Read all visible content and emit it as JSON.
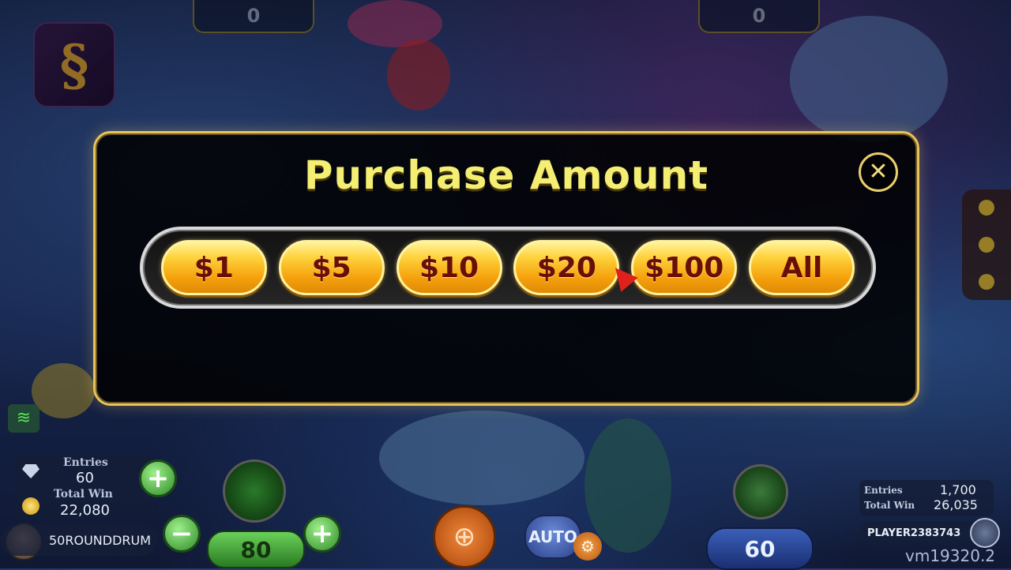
{
  "modal": {
    "title": "Purchase Amount",
    "close_icon": "close-icon",
    "amounts": [
      "$1",
      "$5",
      "$10",
      "$20",
      "$100",
      "All"
    ]
  },
  "top": {
    "left_counter": "0",
    "right_counter": "0"
  },
  "hud_left": {
    "entries_label": "Entries",
    "entries_value": "60",
    "total_win_label": "Total Win",
    "total_win_value": "22,080",
    "player_name": "50ROUNDDRUM"
  },
  "controls": {
    "bet_value": "80",
    "minus_symbol": "−",
    "plus_symbol": "+",
    "auto_label": "AUTO",
    "opponent_bet": "60"
  },
  "hud_right": {
    "entries_label": "Entries",
    "entries_value": "1,700",
    "total_win_label": "Total Win",
    "total_win_value": "26,035",
    "player_name": "PLAYER2383743"
  },
  "version": "vm19320.2",
  "colors": {
    "title": "#f4ee72",
    "button_text": "#6a0e08",
    "modal_border": "#e8c25a"
  }
}
